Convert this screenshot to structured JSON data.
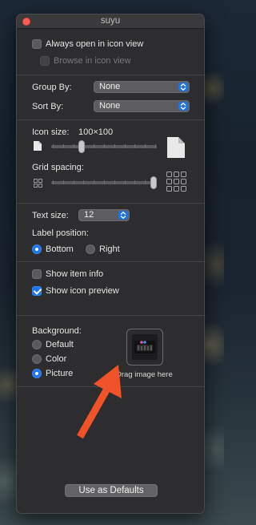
{
  "window": {
    "title": "suyu"
  },
  "view_options": {
    "always_open_icon_view": {
      "label": "Always open in icon view",
      "checked": false
    },
    "browse_icon_view": {
      "label": "Browse in icon view",
      "checked": false,
      "disabled": true
    }
  },
  "grouping": {
    "group_by_label": "Group By:",
    "group_by_value": "None",
    "sort_by_label": "Sort By:",
    "sort_by_value": "None"
  },
  "icon_size": {
    "label": "Icon size:",
    "value_text": "100×100",
    "slider_value": 0.29
  },
  "grid_spacing": {
    "label": "Grid spacing:",
    "slider_value": 1.0
  },
  "text": {
    "text_size_label": "Text size:",
    "text_size_value": "12",
    "label_position_label": "Label position:",
    "options": [
      "Bottom",
      "Right"
    ],
    "selected": "Bottom"
  },
  "item_info": {
    "show_item_info": {
      "label": "Show item info",
      "checked": false
    },
    "show_icon_preview": {
      "label": "Show icon preview",
      "checked": true
    }
  },
  "background": {
    "label": "Background:",
    "options": [
      "Default",
      "Color",
      "Picture"
    ],
    "selected": "Picture",
    "drop_hint": "Drag image here"
  },
  "footer": {
    "use_as_defaults_label": "Use as Defaults"
  },
  "colors": {
    "accent": "#1d73e8",
    "annotation_arrow": "#f0522a",
    "window_bg": "#2d2d2f"
  }
}
